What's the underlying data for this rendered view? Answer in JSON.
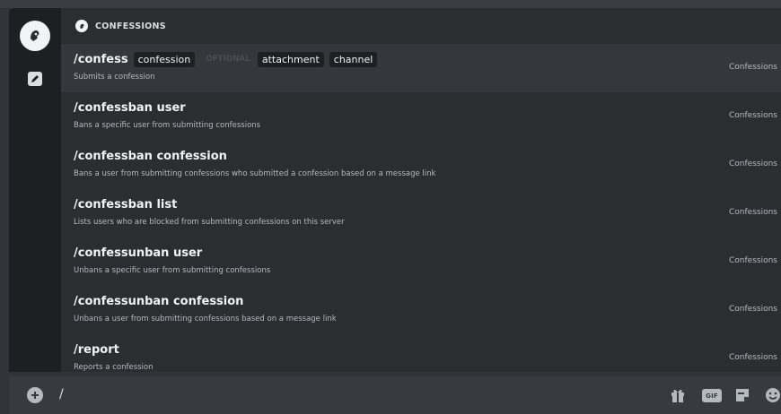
{
  "section": {
    "title": "CONFESSIONS"
  },
  "commands": [
    {
      "name": "/confess",
      "options": [
        "confession"
      ],
      "optional_label": "OPTIONAL",
      "optional_options": [
        "attachment",
        "channel"
      ],
      "description": "Submits a confession",
      "source": "Confessions",
      "selected": true
    },
    {
      "name": "/confessban user",
      "options": [],
      "optional_label": "",
      "optional_options": [],
      "description": "Bans a specific user from submitting confessions",
      "source": "Confessions",
      "selected": false
    },
    {
      "name": "/confessban confession",
      "options": [],
      "optional_label": "",
      "optional_options": [],
      "description": "Bans a user from submitting confessions who submitted a confession based on a message link",
      "source": "Confessions",
      "selected": false
    },
    {
      "name": "/confessban list",
      "options": [],
      "optional_label": "",
      "optional_options": [],
      "description": "Lists users who are blocked from submitting confessions on this server",
      "source": "Confessions",
      "selected": false
    },
    {
      "name": "/confessunban user",
      "options": [],
      "optional_label": "",
      "optional_options": [],
      "description": "Unbans a specific user from submitting confessions",
      "source": "Confessions",
      "selected": false
    },
    {
      "name": "/confessunban confession",
      "options": [],
      "optional_label": "",
      "optional_options": [],
      "description": "Unbans a user from submitting confessions based on a message link",
      "source": "Confessions",
      "selected": false
    },
    {
      "name": "/report",
      "options": [],
      "optional_label": "",
      "optional_options": [],
      "description": "Reports a confession",
      "source": "Confessions",
      "selected": false
    }
  ],
  "input": {
    "value": "/"
  },
  "toolbar": {
    "gif_label": "GIF"
  },
  "icons": {
    "rail_app": "confessions-app-icon",
    "rail_pen": "pencil-icon",
    "section": "confessions-app-icon",
    "plus": "plus-circle-icon",
    "gift": "gift-icon",
    "sticker": "sticker-icon",
    "emoji": "emoji-icon"
  },
  "colors": {
    "background": "#313338",
    "popup": "#2b2d31",
    "rail": "#1e1f22",
    "selected_row": "#35373c",
    "option_chip": "#1e1f22",
    "input_bar": "#383a40"
  }
}
